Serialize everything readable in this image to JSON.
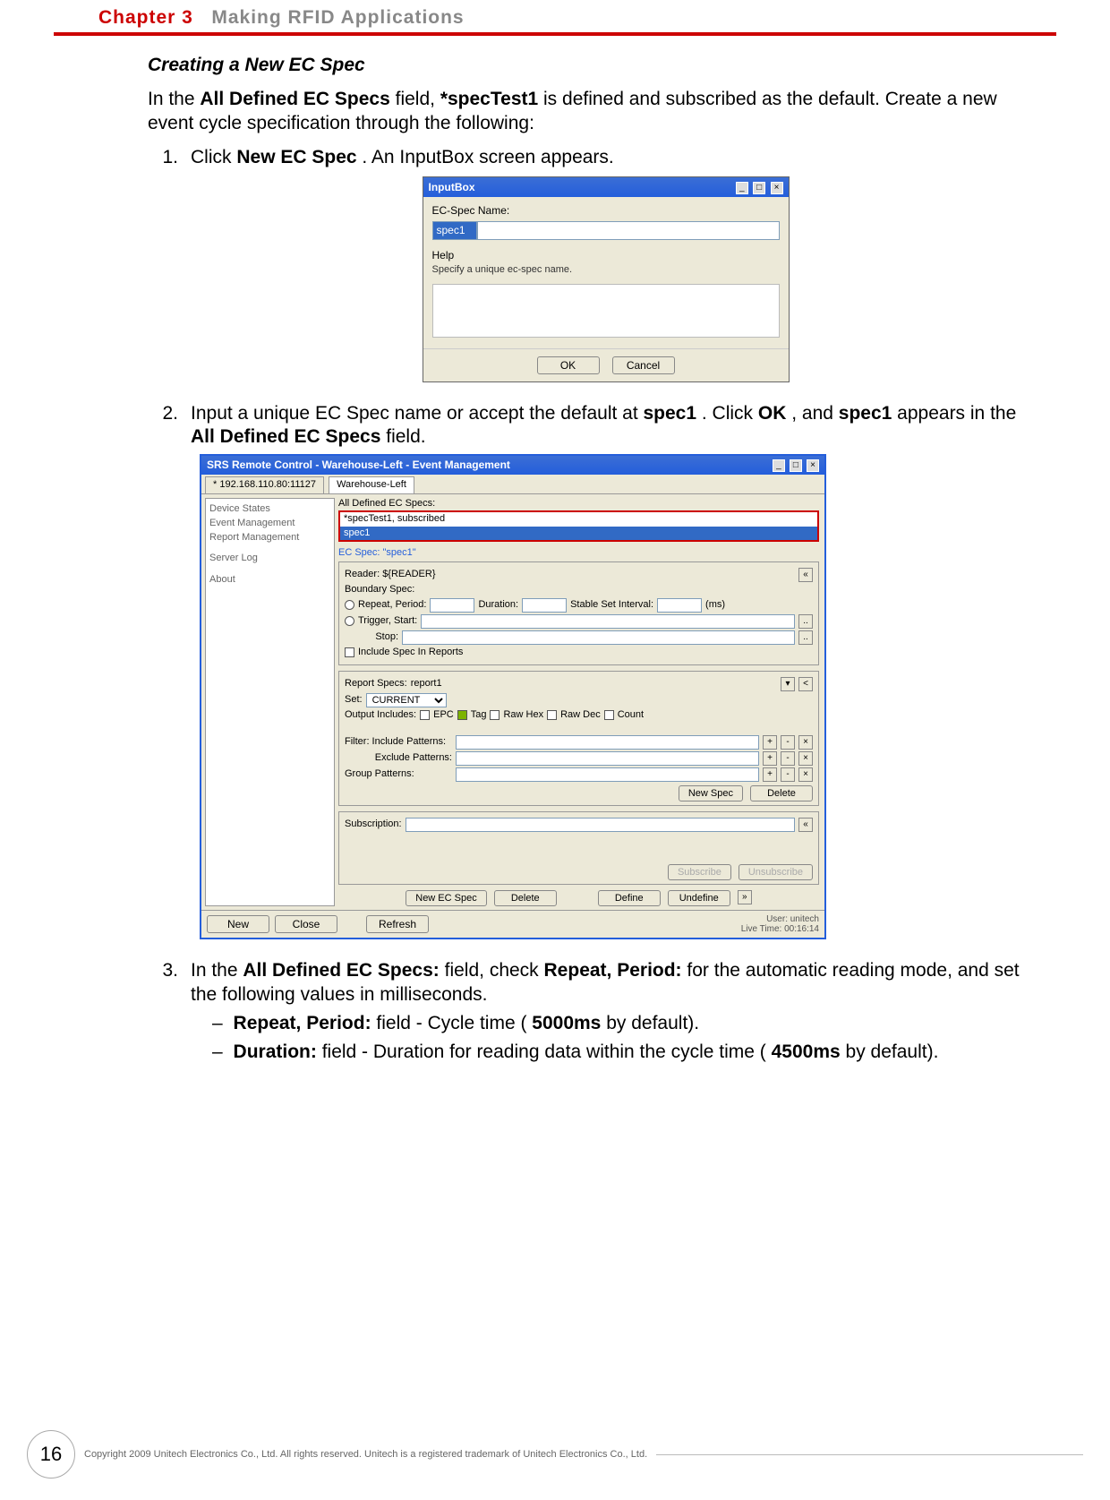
{
  "chapter": {
    "num": "Chapter 3",
    "title": "Making RFID Applications"
  },
  "section_title": "Creating a New EC Spec",
  "intro": {
    "t1": "In the ",
    "b1": "All Defined EC Specs",
    "t2": " field, ",
    "b2": "*specTest1",
    "t3": " is defined and subscribed as the default. Create a new event cycle specification through the following:"
  },
  "steps": {
    "s1": {
      "num": "1.",
      "t1": "Click ",
      "b1": "New EC Spec",
      "t2": ". An InputBox screen appears."
    },
    "s2": {
      "num": "2.",
      "t1": "Input a unique EC Spec name or accept the default at ",
      "b1": "spec1",
      "t2": ". Click ",
      "b2": "OK",
      "t3": ", and ",
      "b3": "spec1",
      "t4": " appears in the ",
      "b4": "All Defined EC Specs",
      "t5": " field."
    },
    "s3": {
      "num": "3.",
      "t1": "In the ",
      "b1": "All Defined EC Specs:",
      "t2": " field, check ",
      "b2": "Repeat, Period:",
      "t3": " for the automatic reading mode, and set the following values in milliseconds.",
      "sub1": {
        "b": "Repeat, Period:",
        "t1": " field - Cycle time (",
        "b2": "5000ms",
        "t2": " by default)."
      },
      "sub2": {
        "b": "Duration:",
        "t1": " field - Duration for reading data within the cycle time (",
        "b2": "4500ms",
        "t2": " by default)."
      }
    }
  },
  "inputbox": {
    "title": "InputBox",
    "ec_spec_label": "EC-Spec Name:",
    "ec_spec_value": "spec1",
    "help_label": "Help",
    "help_text": "Specify a unique ec-spec name.",
    "ok": "OK",
    "cancel": "Cancel"
  },
  "srs": {
    "title": "SRS Remote Control - Warehouse-Left - Event Management",
    "tab_ip": "* 192.168.110.80:11127",
    "tab_wh": "Warehouse-Left",
    "nav": {
      "n1": "Device States",
      "n2": "Event Management",
      "n3": "Report Management",
      "n4": "Server Log",
      "n5": "About"
    },
    "all_defined_label": "All Defined EC Specs:",
    "list_row1": "*specTest1, subscribed",
    "list_row2": "spec1",
    "ec_spec_header": "EC Spec: \"spec1\"",
    "reader_label": "Reader: ${READER}",
    "boundary_label": "Boundary Spec:",
    "repeat_period": "Repeat, Period:",
    "duration": "Duration:",
    "stable_set": "Stable Set Interval:",
    "ms": "(ms)",
    "trigger_start": "Trigger, Start:",
    "stop": "Stop:",
    "include_spec": "Include Spec In Reports",
    "report_specs": "Report Specs:",
    "report_specs_val": "report1",
    "set": "Set:",
    "set_val": "CURRENT",
    "output_includes": "Output Includes:",
    "out_epc": "EPC",
    "out_tag": "Tag",
    "out_rawhex": "Raw Hex",
    "out_rawdec": "Raw Dec",
    "out_count": "Count",
    "filter_include": "Filter: Include Patterns:",
    "exclude": "Exclude Patterns:",
    "group": "Group Patterns:",
    "new_spec_btn": "New Spec",
    "delete_btn": "Delete",
    "subscription": "Subscription:",
    "subscribe": "Subscribe",
    "unsubscribe": "Unsubscribe",
    "new_ec_spec": "New EC Spec",
    "delete2": "Delete",
    "define": "Define",
    "undefine": "Undefine",
    "new_btn": "New",
    "close_btn": "Close",
    "refresh_btn": "Refresh",
    "user": "User: unitech",
    "livetime": "Live Time: 00:16:14"
  },
  "footer": {
    "page": "16",
    "copyright": "Copyright 2009 Unitech Electronics Co., Ltd. All rights reserved. Unitech is a registered trademark of Unitech Electronics Co., Ltd."
  }
}
